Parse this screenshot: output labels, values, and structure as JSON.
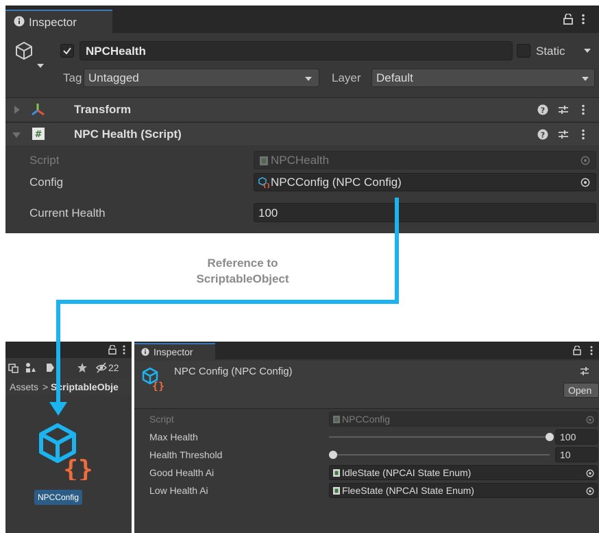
{
  "top_inspector": {
    "tab_label": "Inspector",
    "object_name": "NPCHealth",
    "static_label": "Static",
    "tag_label": "Tag",
    "tag_value": "Untagged",
    "layer_label": "Layer",
    "layer_value": "Default",
    "components": [
      {
        "name": "Transform",
        "expanded": false
      },
      {
        "name": "NPC Health (Script)",
        "expanded": true
      }
    ],
    "fields": {
      "script_label": "Script",
      "script_value": "NPCHealth",
      "config_label": "Config",
      "config_value": "NPCConfig (NPC Config)",
      "current_health_label": "Current Health",
      "current_health_value": "100"
    }
  },
  "annotation": {
    "line1": "Reference to",
    "line2": "ScriptableObject",
    "arrow_color": "#1ab4f0"
  },
  "project_panel": {
    "hidden_count": "22",
    "breadcrumb_root": "Assets",
    "breadcrumb_sep": ">",
    "breadcrumb_folder": "ScriptableObje",
    "asset_name": "NPCConfig"
  },
  "bottom_inspector": {
    "tab_label": "Inspector",
    "title": "NPC Config (NPC Config)",
    "open_button": "Open",
    "fields": {
      "script_label": "Script",
      "script_value": "NPCConfig",
      "max_health_label": "Max Health",
      "max_health_value": "100",
      "max_health_slider": 1.0,
      "health_threshold_label": "Health Threshold",
      "health_threshold_value": "10",
      "health_threshold_slider": 0.0,
      "good_health_label": "Good Health Ai",
      "good_health_value": "IdleState (NPCAI State Enum)",
      "low_health_label": "Low Health Ai",
      "low_health_value": "FleeState (NPCAI State Enum)"
    }
  },
  "colors": {
    "panel_bg": "#383838",
    "field_bg": "#2a2a2a",
    "selection_blue": "#2c5d87",
    "brackets_orange": "#f26b3a"
  }
}
